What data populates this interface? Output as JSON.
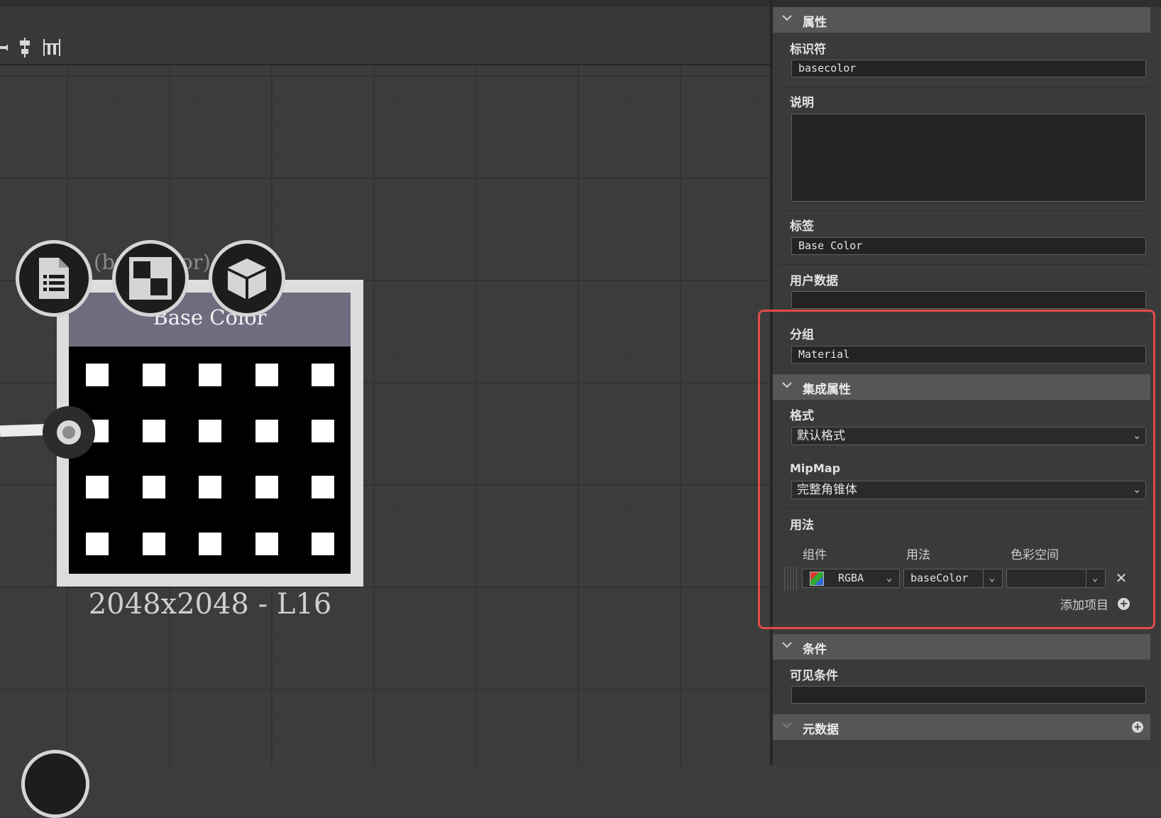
{
  "graph": {
    "node": {
      "title": "Base Color",
      "ghost_label": "(basecolor)",
      "resolution": "2048x2048 - L16",
      "badges": [
        "document-icon",
        "checker-icon",
        "cube-icon"
      ]
    }
  },
  "panel": {
    "sections": {
      "attributes": "属性",
      "integration": "集成属性",
      "conditions": "条件",
      "metadata": "元数据"
    },
    "identifier": {
      "label": "标识符",
      "value": "basecolor"
    },
    "description": {
      "label": "说明",
      "value": ""
    },
    "label_field": {
      "label": "标签",
      "value": "Base Color"
    },
    "user_data": {
      "label": "用户数据",
      "value": ""
    },
    "group": {
      "label": "分组",
      "value": "Material"
    },
    "format": {
      "label": "格式",
      "value": "默认格式"
    },
    "mipmap": {
      "label": "MipMap",
      "value": "完整角锥体"
    },
    "usage": {
      "label": "用法",
      "columns": [
        "组件",
        "用法",
        "色彩空间"
      ],
      "rows": [
        {
          "component": "RGBA",
          "usage": "baseColor",
          "colorspace": ""
        }
      ],
      "add_label": "添加项目"
    },
    "visible_condition": {
      "label": "可见条件",
      "value": ""
    }
  },
  "colors": {
    "highlight": "#e24b4b",
    "node_header": "#706c80",
    "graph_bg": "#3c3c3c"
  }
}
